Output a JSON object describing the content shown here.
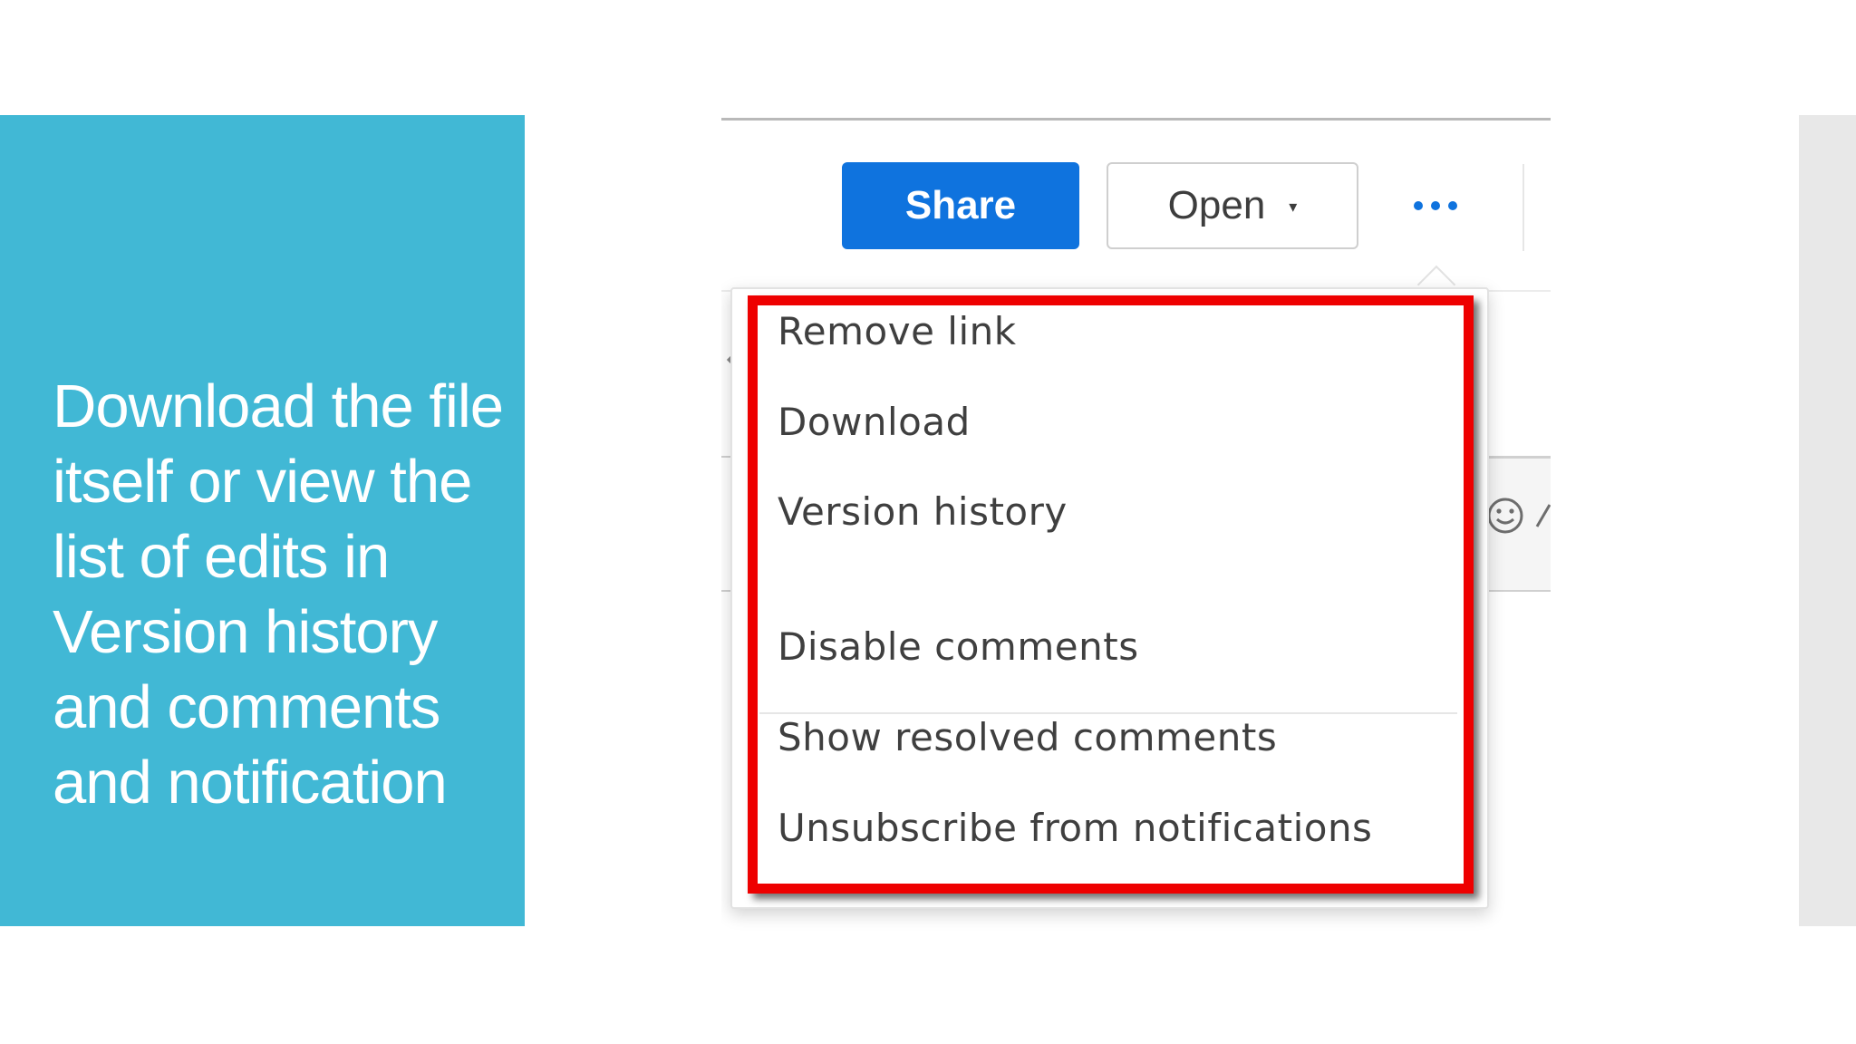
{
  "slide": {
    "text": "Download the file itself or view the list of edits in Version history and comments and notification",
    "panel_color": "#41b8d5"
  },
  "toolbar": {
    "share_label": "Share",
    "open_label": "Open",
    "open_caret": "▾",
    "more_icon": "more-horizontal-icon",
    "accent_color": "#0f73de"
  },
  "menu": {
    "items": [
      {
        "label": "Remove link"
      },
      {
        "label": "Download"
      },
      {
        "label": "Version history"
      },
      {
        "label": "Disable comments"
      },
      {
        "label": "Show resolved comments"
      },
      {
        "label": "Unsubscribe from notifications"
      }
    ],
    "highlight_color": "#ee0000"
  }
}
